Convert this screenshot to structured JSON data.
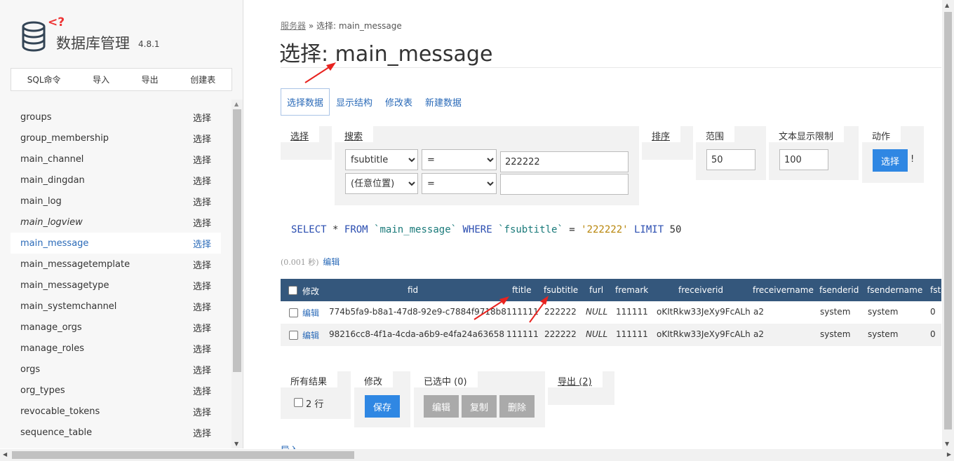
{
  "app": {
    "logo_code": "<?",
    "title": "数据库管理",
    "version": "4.8.1"
  },
  "sidebar": {
    "tools": [
      "SQL命令",
      "导入",
      "导出",
      "创建表"
    ],
    "select_label": "选择",
    "tables": [
      {
        "name": "groups"
      },
      {
        "name": "group_membership"
      },
      {
        "name": "main_channel"
      },
      {
        "name": "main_dingdan"
      },
      {
        "name": "main_log"
      },
      {
        "name": "main_logview",
        "view": true
      },
      {
        "name": "main_message",
        "active": true
      },
      {
        "name": "main_messagetemplate"
      },
      {
        "name": "main_messagetype"
      },
      {
        "name": "main_systemchannel"
      },
      {
        "name": "manage_orgs"
      },
      {
        "name": "manage_roles"
      },
      {
        "name": "orgs"
      },
      {
        "name": "org_types"
      },
      {
        "name": "revocable_tokens"
      },
      {
        "name": "sequence_table"
      }
    ]
  },
  "breadcrumb": {
    "server_link": "服务器",
    "separator": "»",
    "current": "选择: main_message"
  },
  "page_title": {
    "prefix": "选择: ",
    "table": "main_message"
  },
  "tabs": [
    "选择数据",
    "显示结构",
    "修改表",
    "新建数据"
  ],
  "filters": {
    "select_legend": "选择",
    "search_legend": "搜索",
    "search_rows": [
      {
        "column": "fsubtitle",
        "operator": "=",
        "value": "222222"
      },
      {
        "column": "(任意位置)",
        "operator": "=",
        "value": ""
      }
    ],
    "order_legend": "排序",
    "limit_legend": "范围",
    "limit_value": "50",
    "text_length_legend": "文本显示限制",
    "text_length_value": "100",
    "action_legend": "动作",
    "action_button": "选择",
    "action_extra": "!"
  },
  "sql": {
    "select": "SELECT",
    "star": "*",
    "from": "FROM",
    "table": "`main_message`",
    "where": "WHERE",
    "column": "`fsubtitle`",
    "eq": "=",
    "value": "'222222'",
    "limit": "LIMIT",
    "limit_value": "50"
  },
  "timing": {
    "elapsed": "(0.001 秒)",
    "edit_link": "编辑"
  },
  "results": {
    "headers": [
      "修改",
      "fid",
      "ftitle",
      "fsubtitle",
      "furl",
      "fremark",
      "freceiverid",
      "freceivername",
      "fsenderid",
      "fsendername",
      "fsta"
    ],
    "rows": [
      {
        "edit": "编辑",
        "fid": "774b5fa9-b8a1-47d8-92e9-c7884f9718b8",
        "ftitle": "111111",
        "fsubtitle": "222222",
        "furl": "NULL",
        "fremark": "111111",
        "freceiverid": "oKItRkw33JeXy9FcALh",
        "freceivername": "a2",
        "fsenderid": "system",
        "fsendername": "system",
        "fsta": "0"
      },
      {
        "edit": "编辑",
        "fid": "98216cc8-4f1a-4cda-a6b9-e4fa24a63658",
        "ftitle": "111111",
        "fsubtitle": "222222",
        "furl": "NULL",
        "fremark": "111111",
        "freceiverid": "oKItRkw33JeXy9FcALh",
        "freceivername": "a2",
        "fsenderid": "system",
        "fsendername": "system",
        "fsta": "0"
      }
    ]
  },
  "bottom": {
    "all_results_legend": "所有结果",
    "all_results_count": "2 行",
    "modify_legend": "修改",
    "save_button": "保存",
    "selected_legend": "已选中 (0)",
    "edit_button": "编辑",
    "copy_button": "复制",
    "delete_button": "删除",
    "export_legend": "导出 (2)",
    "cut_link": "导入"
  },
  "colors": {
    "accent": "#2a6ab8",
    "header_bg": "#34577c",
    "button_blue": "#2f87e3",
    "annotation_arrow": "#e8231f"
  }
}
